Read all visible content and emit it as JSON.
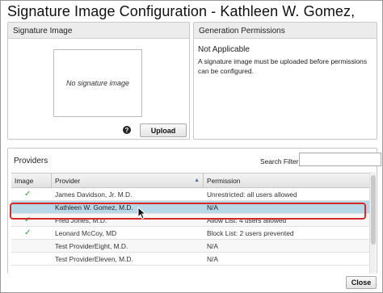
{
  "window": {
    "title": "Signature Image Configuration - Kathleen W. Gomez, M.D."
  },
  "signature_panel": {
    "header": "Signature Image",
    "placeholder": "No signature image",
    "help_glyph": "?",
    "upload_label": "Upload"
  },
  "generation_panel": {
    "header": "Generation Permissions",
    "status": "Not Applicable",
    "description": "A signature image must be uploaded before permissions can be configured."
  },
  "providers_panel": {
    "header": "Providers",
    "search_label": "Search Filter:",
    "search_value": "",
    "columns": {
      "image": "Image",
      "provider": "Provider",
      "permission": "Permission"
    },
    "rows": [
      {
        "has_image": true,
        "check": "✓",
        "provider": "James Davidson, Jr. M.D.",
        "permission": "Unrestricted: all users allowed"
      },
      {
        "has_image": false,
        "check": "",
        "provider": "Kathleen W. Gomez, M.D.",
        "permission": "N/A",
        "selected": true
      },
      {
        "has_image": true,
        "check": "✓",
        "provider": "Fred Jones, M.D.",
        "permission": "Allow List: 4 users allowed"
      },
      {
        "has_image": true,
        "check": "✓",
        "provider": "Leonard McCoy, MD",
        "permission": "Block List: 2 users prevented"
      },
      {
        "has_image": false,
        "check": "",
        "provider": "Test ProviderEight, M.D.",
        "permission": "N/A"
      },
      {
        "has_image": false,
        "check": "",
        "provider": "Test ProviderEleven, M.D.",
        "permission": "N/A"
      }
    ]
  },
  "footer": {
    "close_label": "Close"
  },
  "colors": {
    "selected_row": "#b8d8e8",
    "highlight_border": "#d62a2a",
    "check": "#3a9a3a"
  }
}
